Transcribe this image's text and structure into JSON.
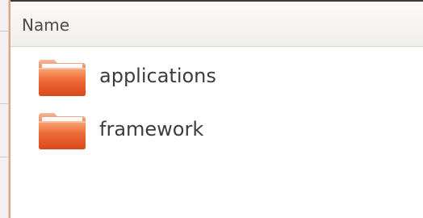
{
  "column_header": {
    "label": "Name"
  },
  "files": [
    {
      "name": "applications",
      "icon": "folder-icon"
    },
    {
      "name": "framework",
      "icon": "folder-icon"
    }
  ],
  "colors": {
    "folder_orange": "#e8572a",
    "folder_light": "#f5a070",
    "accent": "#e8a080"
  }
}
